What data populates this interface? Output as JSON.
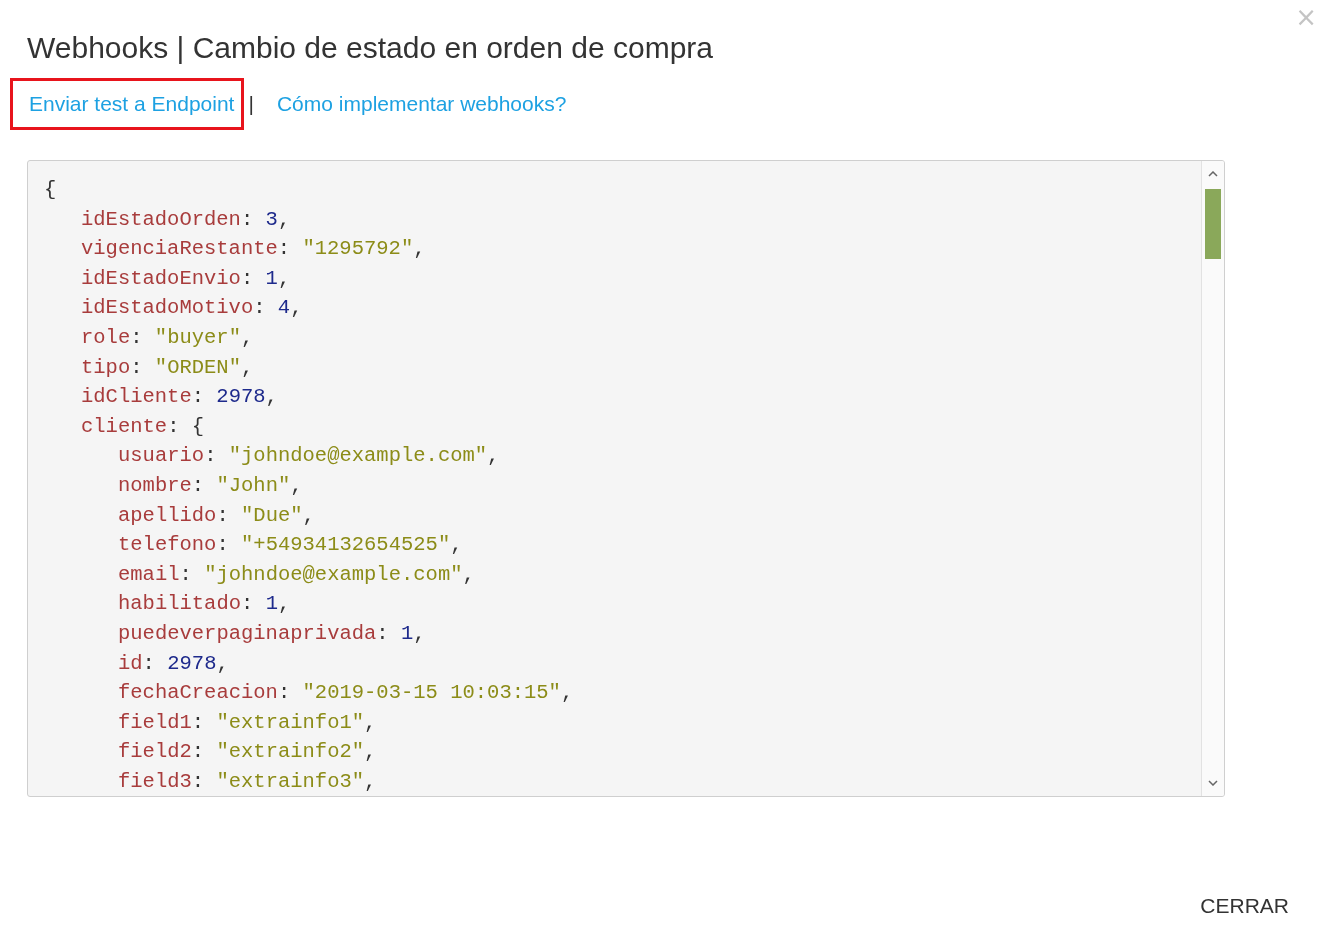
{
  "dialog": {
    "close": "×",
    "title": "Webhooks | Cambio de estado en orden de compra",
    "links": [
      {
        "label": "Enviar test a Endpoint",
        "highlighted": true
      },
      {
        "label": "Cómo implementar webhooks?",
        "highlighted": false
      }
    ],
    "separator": "|",
    "code": {
      "open": "{",
      "entries": [
        {
          "kind": "number",
          "key": "idEstadoOrden",
          "colon": ":",
          "value": "3",
          "comma": ","
        },
        {
          "kind": "string",
          "key": "vigenciaRestante",
          "colon": ":",
          "value": "\"1295792\"",
          "comma": ","
        },
        {
          "kind": "number",
          "key": "idEstadoEnvio",
          "colon": ":",
          "value": "1",
          "comma": ","
        },
        {
          "kind": "number",
          "key": "idEstadoMotivo",
          "colon": ":",
          "value": "4",
          "comma": ","
        },
        {
          "kind": "string",
          "key": "role",
          "colon": ":",
          "value": "\"buyer\"",
          "comma": ","
        },
        {
          "kind": "string",
          "key": "tipo",
          "colon": ":",
          "value": "\"ORDEN\"",
          "comma": ","
        },
        {
          "kind": "number",
          "key": "idCliente",
          "colon": ":",
          "value": "2978",
          "comma": ","
        },
        {
          "kind": "object",
          "key": "cliente",
          "colon": ":",
          "open": "{",
          "children": [
            {
              "kind": "string",
              "key": "usuario",
              "colon": ":",
              "value": "\"johndoe@example.com\"",
              "comma": ","
            },
            {
              "kind": "string",
              "key": "nombre",
              "colon": ":",
              "value": "\"John\"",
              "comma": ","
            },
            {
              "kind": "string",
              "key": "apellido",
              "colon": ":",
              "value": "\"Due\"",
              "comma": ","
            },
            {
              "kind": "string",
              "key": "telefono",
              "colon": ":",
              "value": "\"+54934132654525\"",
              "comma": ","
            },
            {
              "kind": "string",
              "key": "email",
              "colon": ":",
              "value": "\"johndoe@example.com\"",
              "comma": ","
            },
            {
              "kind": "number",
              "key": "habilitado",
              "colon": ":",
              "value": "1",
              "comma": ","
            },
            {
              "kind": "number",
              "key": "puedeverpaginaprivada",
              "colon": ":",
              "value": "1",
              "comma": ","
            },
            {
              "kind": "number",
              "key": "id",
              "colon": ":",
              "value": "2978",
              "comma": ","
            },
            {
              "kind": "string",
              "key": "fechaCreacion",
              "colon": ":",
              "value": "\"2019-03-15 10:03:15\"",
              "comma": ","
            },
            {
              "kind": "string",
              "key": "field1",
              "colon": ":",
              "value": "\"extrainfo1\"",
              "comma": ","
            },
            {
              "kind": "string",
              "key": "field2",
              "colon": ":",
              "value": "\"extrainfo2\"",
              "comma": ","
            },
            {
              "kind": "string",
              "key": "field3",
              "colon": ":",
              "value": "\"extrainfo3\"",
              "comma": ","
            }
          ]
        }
      ]
    },
    "button": "CERRAR"
  }
}
